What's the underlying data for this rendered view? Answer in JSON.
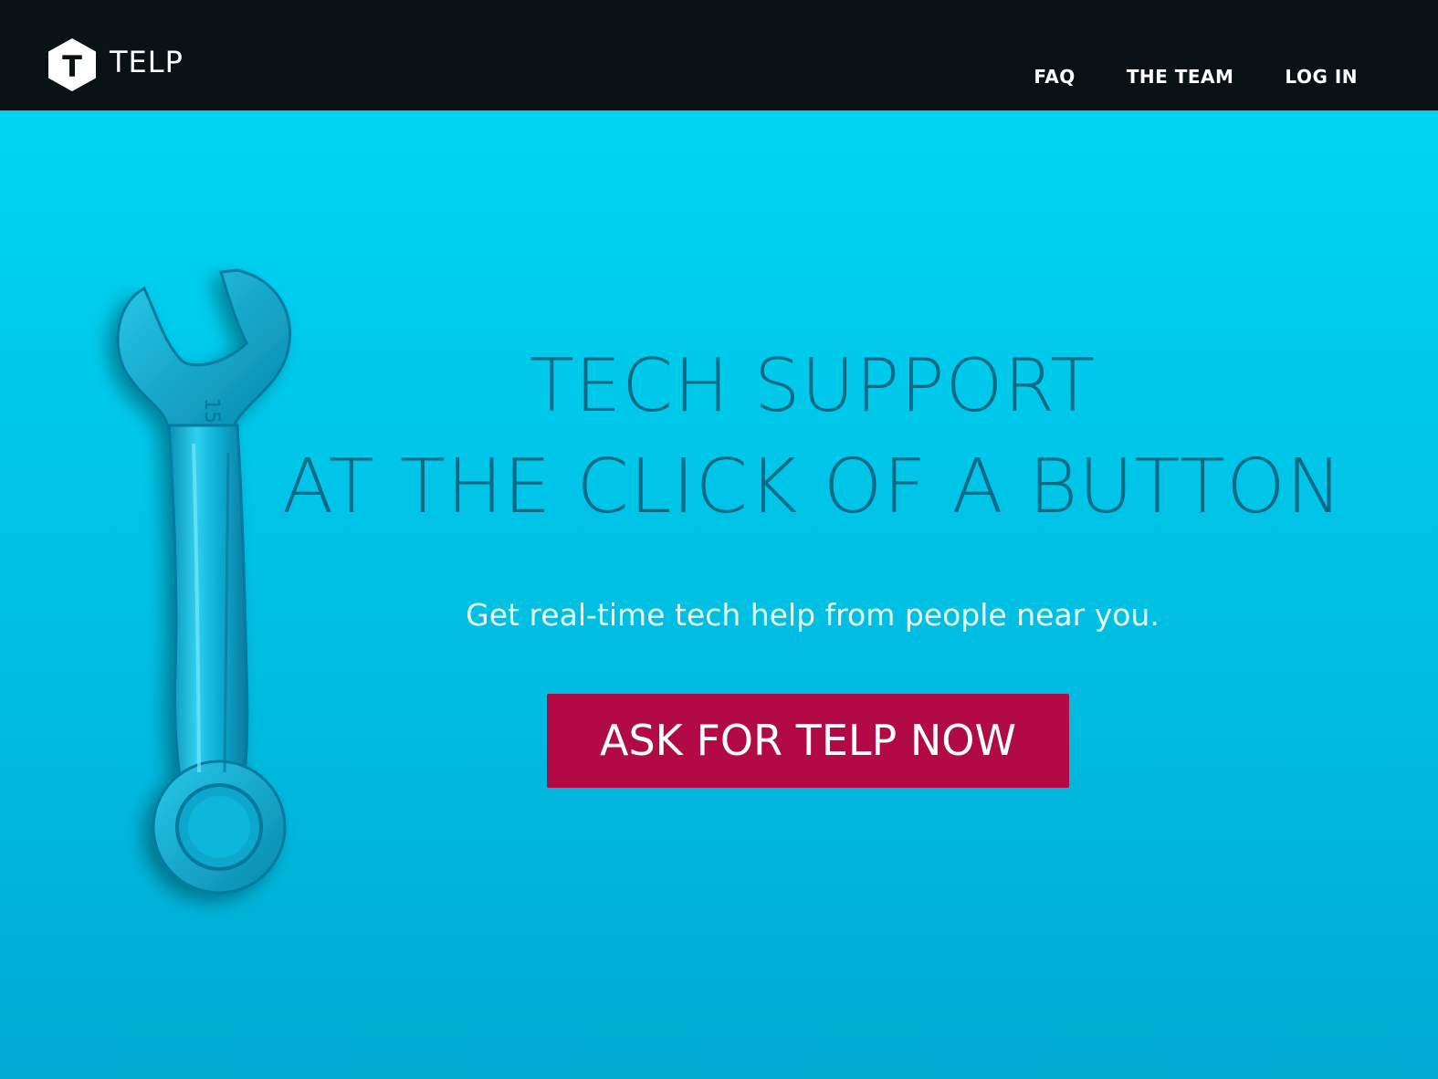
{
  "brand": {
    "name": "TELP",
    "logo_letter": "T",
    "logo_icon": "hexagon-t-logo-icon"
  },
  "nav": {
    "items": [
      {
        "label": "FAQ"
      },
      {
        "label": "THE TEAM"
      },
      {
        "label": "LOG IN"
      }
    ]
  },
  "hero": {
    "headline_line1": "TECH SUPPORT",
    "headline_line2": "AT THE CLICK OF A BUTTON",
    "subheadline": "Get real-time tech help from people near you.",
    "cta_label": "ASK FOR TELP NOW",
    "illustration": "wrench-icon",
    "wrench_size_marking": "15"
  },
  "colors": {
    "navbar_bg": "#0a1216",
    "hero_bg_top": "#00d5f4",
    "hero_bg_bottom": "#00abd2",
    "headline": "#0a6a86",
    "cta_bg": "#b20a44",
    "text_light": "#ffffff"
  }
}
